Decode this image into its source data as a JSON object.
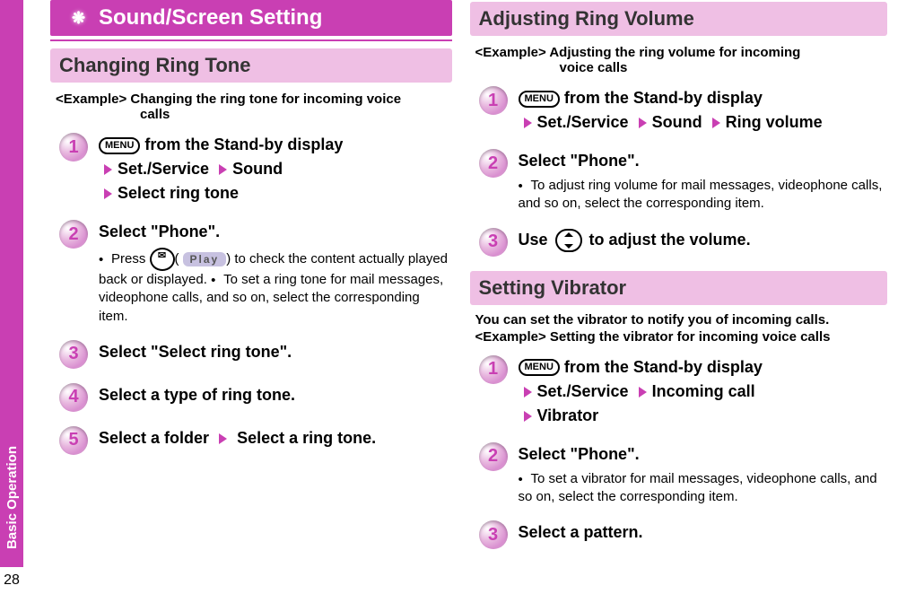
{
  "sidebar": {
    "label": "Basic Operation",
    "page": "28"
  },
  "left": {
    "banner": "Sound/Screen Setting",
    "banner_icon": "❋",
    "section1": {
      "title": "Changing Ring Tone",
      "example_label": "<Example>",
      "example_body": "Changing the ring tone for incoming voice",
      "example_cont": "calls",
      "steps": [
        {
          "num": "1",
          "menu_key": "MENU",
          "line1": "from the Stand-by display",
          "line2a": "Set./Service",
          "line2b": "Sound",
          "line3": "Select ring tone"
        },
        {
          "num": "2",
          "title": "Select \"Phone\".",
          "note1_pre": "Press ",
          "note1_key": "✉",
          "note1_play": "Play",
          "note1_post": " to check the content actually played back or displayed.",
          "note2": "To set a ring tone for mail messages, videophone calls, and so on, select the corresponding item."
        },
        {
          "num": "3",
          "title": "Select \"Select ring tone\"."
        },
        {
          "num": "4",
          "title": "Select a type of ring tone."
        },
        {
          "num": "5",
          "line_a": "Select a folder",
          "line_b": "Select a ring tone."
        }
      ]
    }
  },
  "right": {
    "section1": {
      "title": "Adjusting Ring Volume",
      "example_label": "<Example>",
      "example_body": "Adjusting the ring volume for incoming",
      "example_cont": "voice calls",
      "steps": [
        {
          "num": "1",
          "menu_key": "MENU",
          "line1": "from the Stand-by display",
          "path": [
            "Set./Service",
            "Sound",
            "Ring volume"
          ]
        },
        {
          "num": "2",
          "title": "Select \"Phone\".",
          "note": "To adjust ring volume for mail messages, videophone calls, and so on, select the corresponding item."
        },
        {
          "num": "3",
          "pre": "Use ",
          "post": " to adjust the volume."
        }
      ]
    },
    "section2": {
      "title": "Setting Vibrator",
      "lead": "You can set the vibrator to notify you of incoming calls.",
      "example_label": "<Example>",
      "example_body": "Setting the vibrator for incoming voice calls",
      "steps": [
        {
          "num": "1",
          "menu_key": "MENU",
          "line1": "from the Stand-by display",
          "path": [
            "Set./Service",
            "Incoming call"
          ],
          "path2": "Vibrator"
        },
        {
          "num": "2",
          "title": "Select \"Phone\".",
          "note": "To set a vibrator for mail messages, videophone calls, and so on, select the corresponding item."
        },
        {
          "num": "3",
          "title": "Select a pattern."
        }
      ]
    }
  }
}
